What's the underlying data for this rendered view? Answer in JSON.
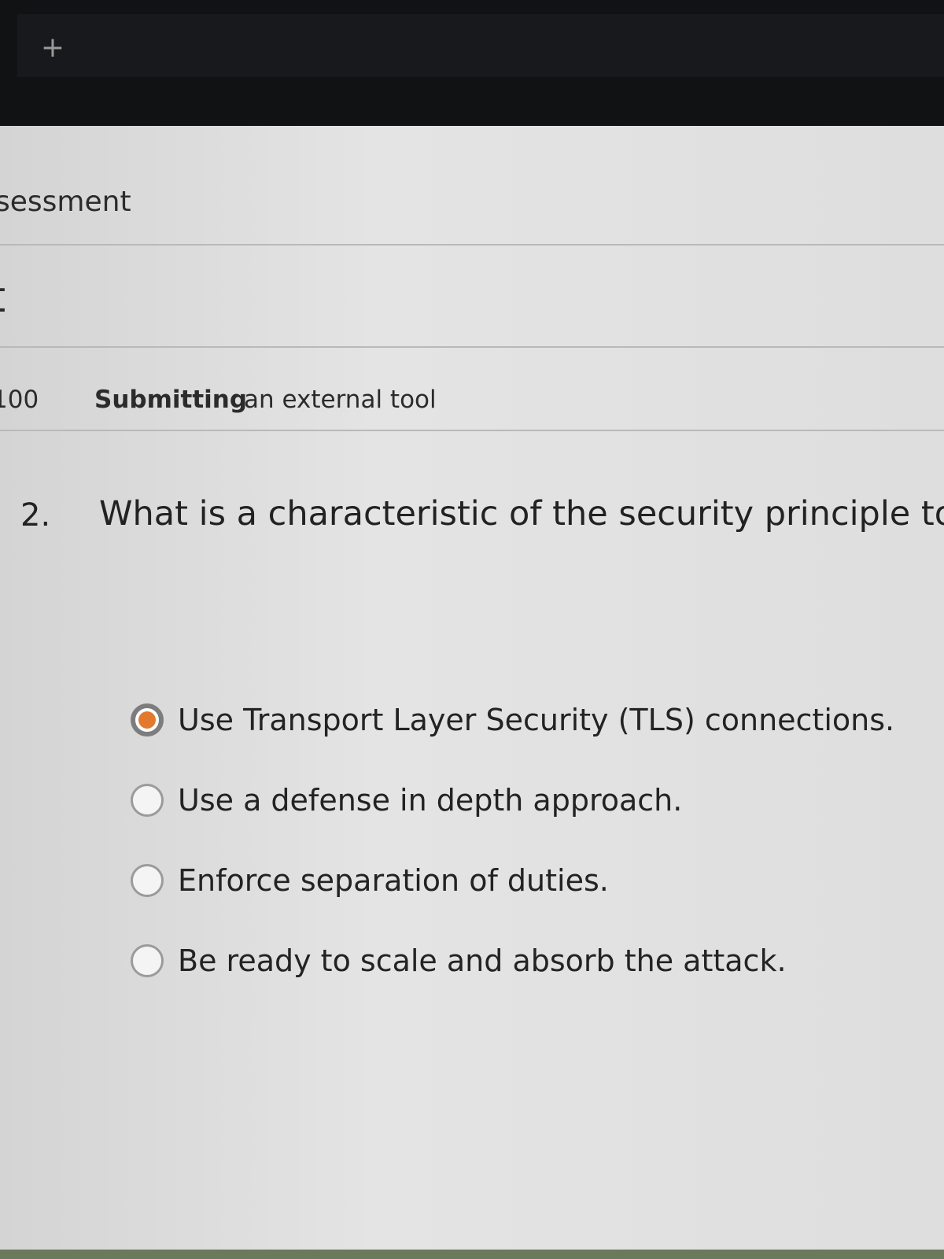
{
  "browser": {
    "new_tab_symbol": "+"
  },
  "course": {
    "title_fragment": "sessment"
  },
  "assessment": {
    "heading_fragment": "t",
    "points_fragment": "100",
    "submitting_label": "Submitting",
    "submitting_detail": "an external tool"
  },
  "question": {
    "number": "2.",
    "text": "What is a characteristic of the security principle to p",
    "answers": [
      {
        "label": "Use Transport Layer Security (TLS) connections.",
        "selected": true
      },
      {
        "label": "Use a defense in depth approach.",
        "selected": false
      },
      {
        "label": "Enforce separation of duties.",
        "selected": false
      },
      {
        "label": "Be ready to scale and absorb the attack.",
        "selected": false
      }
    ]
  },
  "colors": {
    "selected_radio": "#e27a2e",
    "browser_chrome": "#111214"
  }
}
